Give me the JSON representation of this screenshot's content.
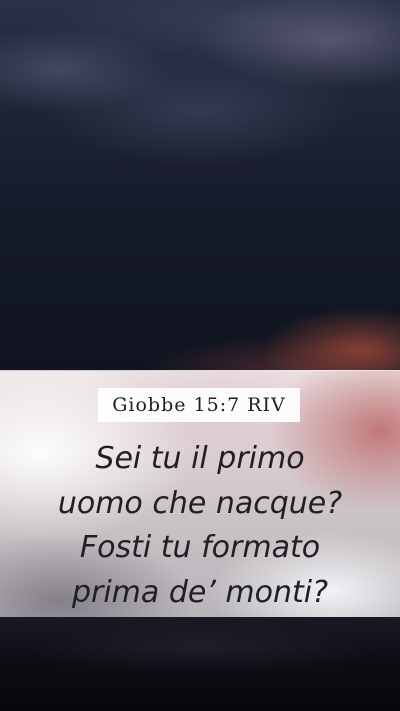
{
  "verse": {
    "reference": "Giobbe 15:7 RIV",
    "lines": [
      "Sei tu il primo",
      "uomo che nacque?",
      "Fosti tu formato",
      "prima de’ monti?"
    ]
  }
}
